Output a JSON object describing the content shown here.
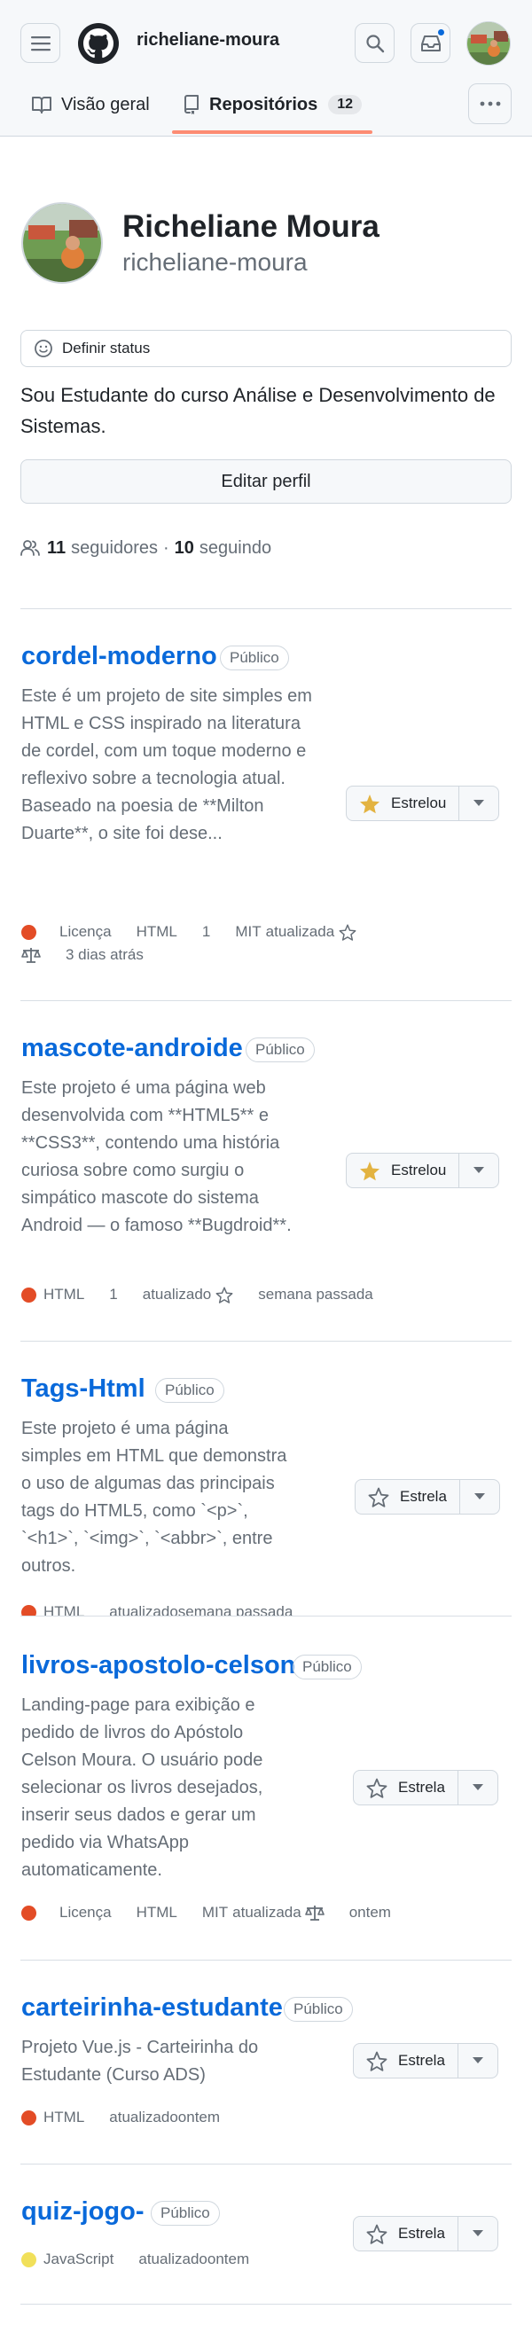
{
  "header": {
    "username": "richeliane-moura",
    "notification_dot_color": "#0969da"
  },
  "tabs": [
    {
      "label": "Visão geral",
      "icon": "book-icon"
    },
    {
      "label": "Repositórios",
      "icon": "repo-icon",
      "count": "12"
    }
  ],
  "profile": {
    "full_name": "Richeliane Moura",
    "username": "richeliane-moura",
    "status_label": "Definir status",
    "bio": "Sou Estudante do curso Análise e Desenvolvimento de Sistemas.",
    "edit_label": "Editar perfil",
    "followers_count": "11",
    "followers_label": "seguidores",
    "separator": "·",
    "following_count": "10",
    "following_label": "seguindo"
  },
  "repos": [
    {
      "name": "cordel-moderno",
      "visibility": "Público",
      "description": "Este é um projeto de site simples em HTML e CSS inspirado na literatura de cordel, com um toque moderno e reflexivo sobre a tecnologia atual. Baseado na poesia de **Milton Duarte**, o site foi dese...",
      "license": "Licença",
      "language": "HTML",
      "lang_color": "#e34c26",
      "stars": "1",
      "license_name": "MIT",
      "updated_label": "atualizada",
      "updated_time": "3 dias atrás",
      "star_label": "Estrelou",
      "starred": true
    },
    {
      "name": "mascote-androide",
      "visibility": "Público",
      "description": "Este projeto é uma página web desenvolvida com **HTML5** e **CSS3**, contendo uma história curiosa sobre como surgiu o simpático mascote do sistema Android — o famoso **Bugdroid**.",
      "language": "HTML",
      "lang_color": "#e34c26",
      "stars": "1",
      "updated_label": "atualizado",
      "updated_time": "semana passada",
      "star_label": "Estrelou",
      "starred": true
    },
    {
      "name": "Tags-Html",
      "visibility": "Público",
      "description": "Este projeto é uma página simples em HTML que demonstra o uso de algumas das principais tags do HTML5, como `<p>`, `<h1>`, `<img>`, `<abbr>`, entre outros.",
      "language": "HTML",
      "lang_color": "#e34c26",
      "updated_label": "atualizado",
      "updated_time": "semana passada",
      "star_label": "Estrela",
      "starred": false
    },
    {
      "name": "livros-apostolo-celson",
      "visibility": "Público",
      "description": "Landing-page para exibição e pedido de livros do Apóstolo Celson Moura. O usuário pode selecionar os livros desejados, inserir seus dados e gerar um pedido via WhatsApp automaticamente.",
      "license": "Licença",
      "language": "HTML",
      "lang_color": "#e34c26",
      "license_name": "MIT",
      "updated_label": "atualizada",
      "updated_time": "ontem",
      "star_label": "Estrela",
      "starred": false
    },
    {
      "name": "carteirinha-estudante",
      "visibility": "Público",
      "description": "Projeto Vue.js - Carteirinha do Estudante (Curso ADS)",
      "language": "HTML",
      "lang_color": "#e34c26",
      "updated_label": "atualizado",
      "updated_time": "ontem",
      "star_label": "Estrela",
      "starred": false
    },
    {
      "name": "quiz-jogo-",
      "visibility": "Público",
      "description": "",
      "language": "JavaScript",
      "lang_color": "#f1e05a",
      "updated_label": "atualizado",
      "updated_time": "ontem",
      "star_label": "Estrela",
      "starred": false
    }
  ]
}
